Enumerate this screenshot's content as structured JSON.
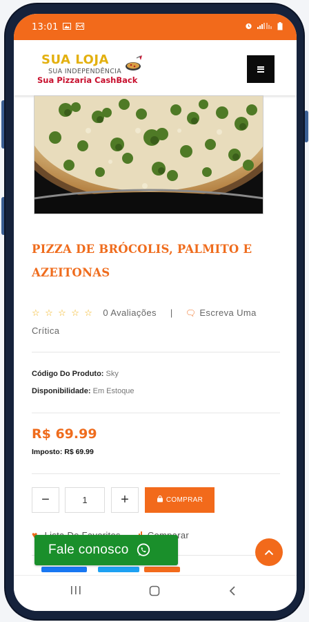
{
  "status_bar": {
    "time": "13:01",
    "left_icons": [
      "image-icon",
      "voicemail-icon"
    ],
    "right_icons": [
      "alarm-icon",
      "signal-icon",
      "battery-icon"
    ]
  },
  "header": {
    "logo_name": "SUA LOJA",
    "logo_tagline": "SUA INDEPENDÊNCIA",
    "logo_subtitle": "Sua Pizzaria CashBack",
    "menu_icon": "hamburger-icon"
  },
  "product": {
    "title": "PIZZA DE BRÓCOLIS, PALMITO E AZEITONAS",
    "rating_count": "0 Avaliações",
    "separator": "|",
    "write_review": "Escreva Uma Crítica",
    "code_label": "Código Do Produto:",
    "code_value": "Sky",
    "availability_label": "Disponibilidade:",
    "availability_value": "Em Estoque",
    "price": "R$ 69.99",
    "tax_label": "Imposto:",
    "tax_value": "R$ 69.99",
    "quantity": "1",
    "decrement": "−",
    "increment": "+",
    "buy_label": "COMPRAR",
    "wishlist_label": "Lista De Favoritos",
    "compare_label": "Comparar"
  },
  "floating": {
    "contact_label": "Fale conosco",
    "back_to_top_icon": "chevron-up-icon"
  },
  "nav_bar": {
    "items": [
      "recent-apps-icon",
      "home-icon",
      "back-icon"
    ]
  },
  "colors": {
    "accent": "#f26a1b",
    "title": "#ef6c1d",
    "star": "#f2b31a",
    "whatsapp_green": "#1a8f2b",
    "logo_yellow": "#e3b00f",
    "logo_red": "#c8102e"
  }
}
